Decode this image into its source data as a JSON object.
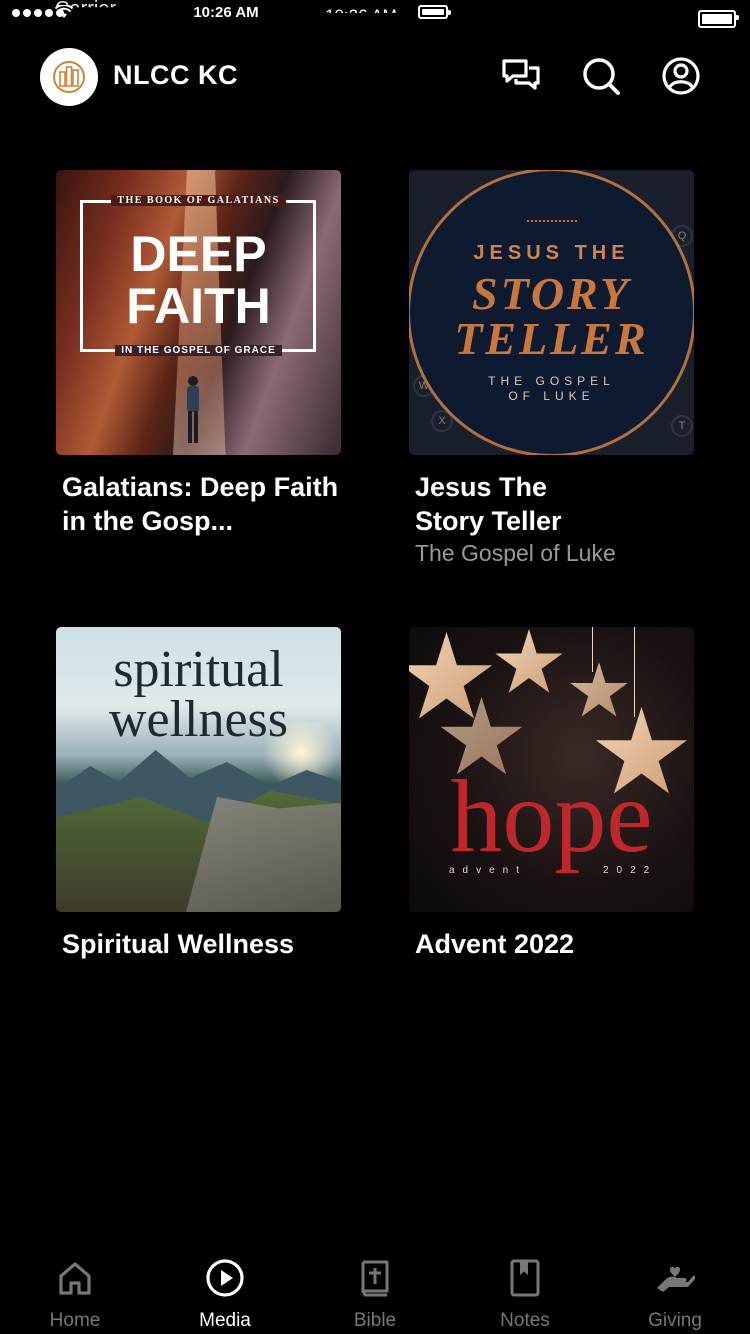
{
  "status_bar": {
    "carrier": "Carrier",
    "time": "10:26 AM",
    "time_ghost": "10:26 AM"
  },
  "header": {
    "title": "NLCC KC",
    "icons": [
      "chat-icon",
      "search-icon",
      "profile-icon"
    ]
  },
  "series": [
    {
      "title": "Galatians: Deep Faith in the Gosp...",
      "subtitle": "",
      "art": {
        "top_line": "THE BOOK OF GALATIANS",
        "line1": "DEEP",
        "line2": "FAITH",
        "bottom_line": "IN THE GOSPEL OF GRACE"
      }
    },
    {
      "title": "Jesus The Story Teller",
      "subtitle": "The Gospel of Luke",
      "art": {
        "line1": "JESUS THE",
        "line2": "STORY",
        "line3": "TELLER",
        "sub1": "THE GOSPEL",
        "sub2": "OF LUKE"
      }
    },
    {
      "title": "Spiritual Wellness",
      "subtitle": "",
      "art": {
        "line1": "spiritual",
        "line2": "wellness"
      }
    },
    {
      "title": "Advent 2022",
      "subtitle": "",
      "art": {
        "word": "hope",
        "left_small": "advent",
        "right_small": "2022"
      }
    }
  ],
  "tabs": [
    {
      "label": "Home",
      "icon": "home-icon",
      "active": false
    },
    {
      "label": "Media",
      "icon": "play-icon",
      "active": true
    },
    {
      "label": "Bible",
      "icon": "bible-icon",
      "active": false
    },
    {
      "label": "Notes",
      "icon": "notes-icon",
      "active": false
    },
    {
      "label": "Giving",
      "icon": "giving-icon",
      "active": false
    }
  ],
  "colors": {
    "background": "#000000",
    "text_primary": "#ffffff",
    "text_secondary": "#9a9a9a",
    "tab_inactive": "#777777"
  }
}
